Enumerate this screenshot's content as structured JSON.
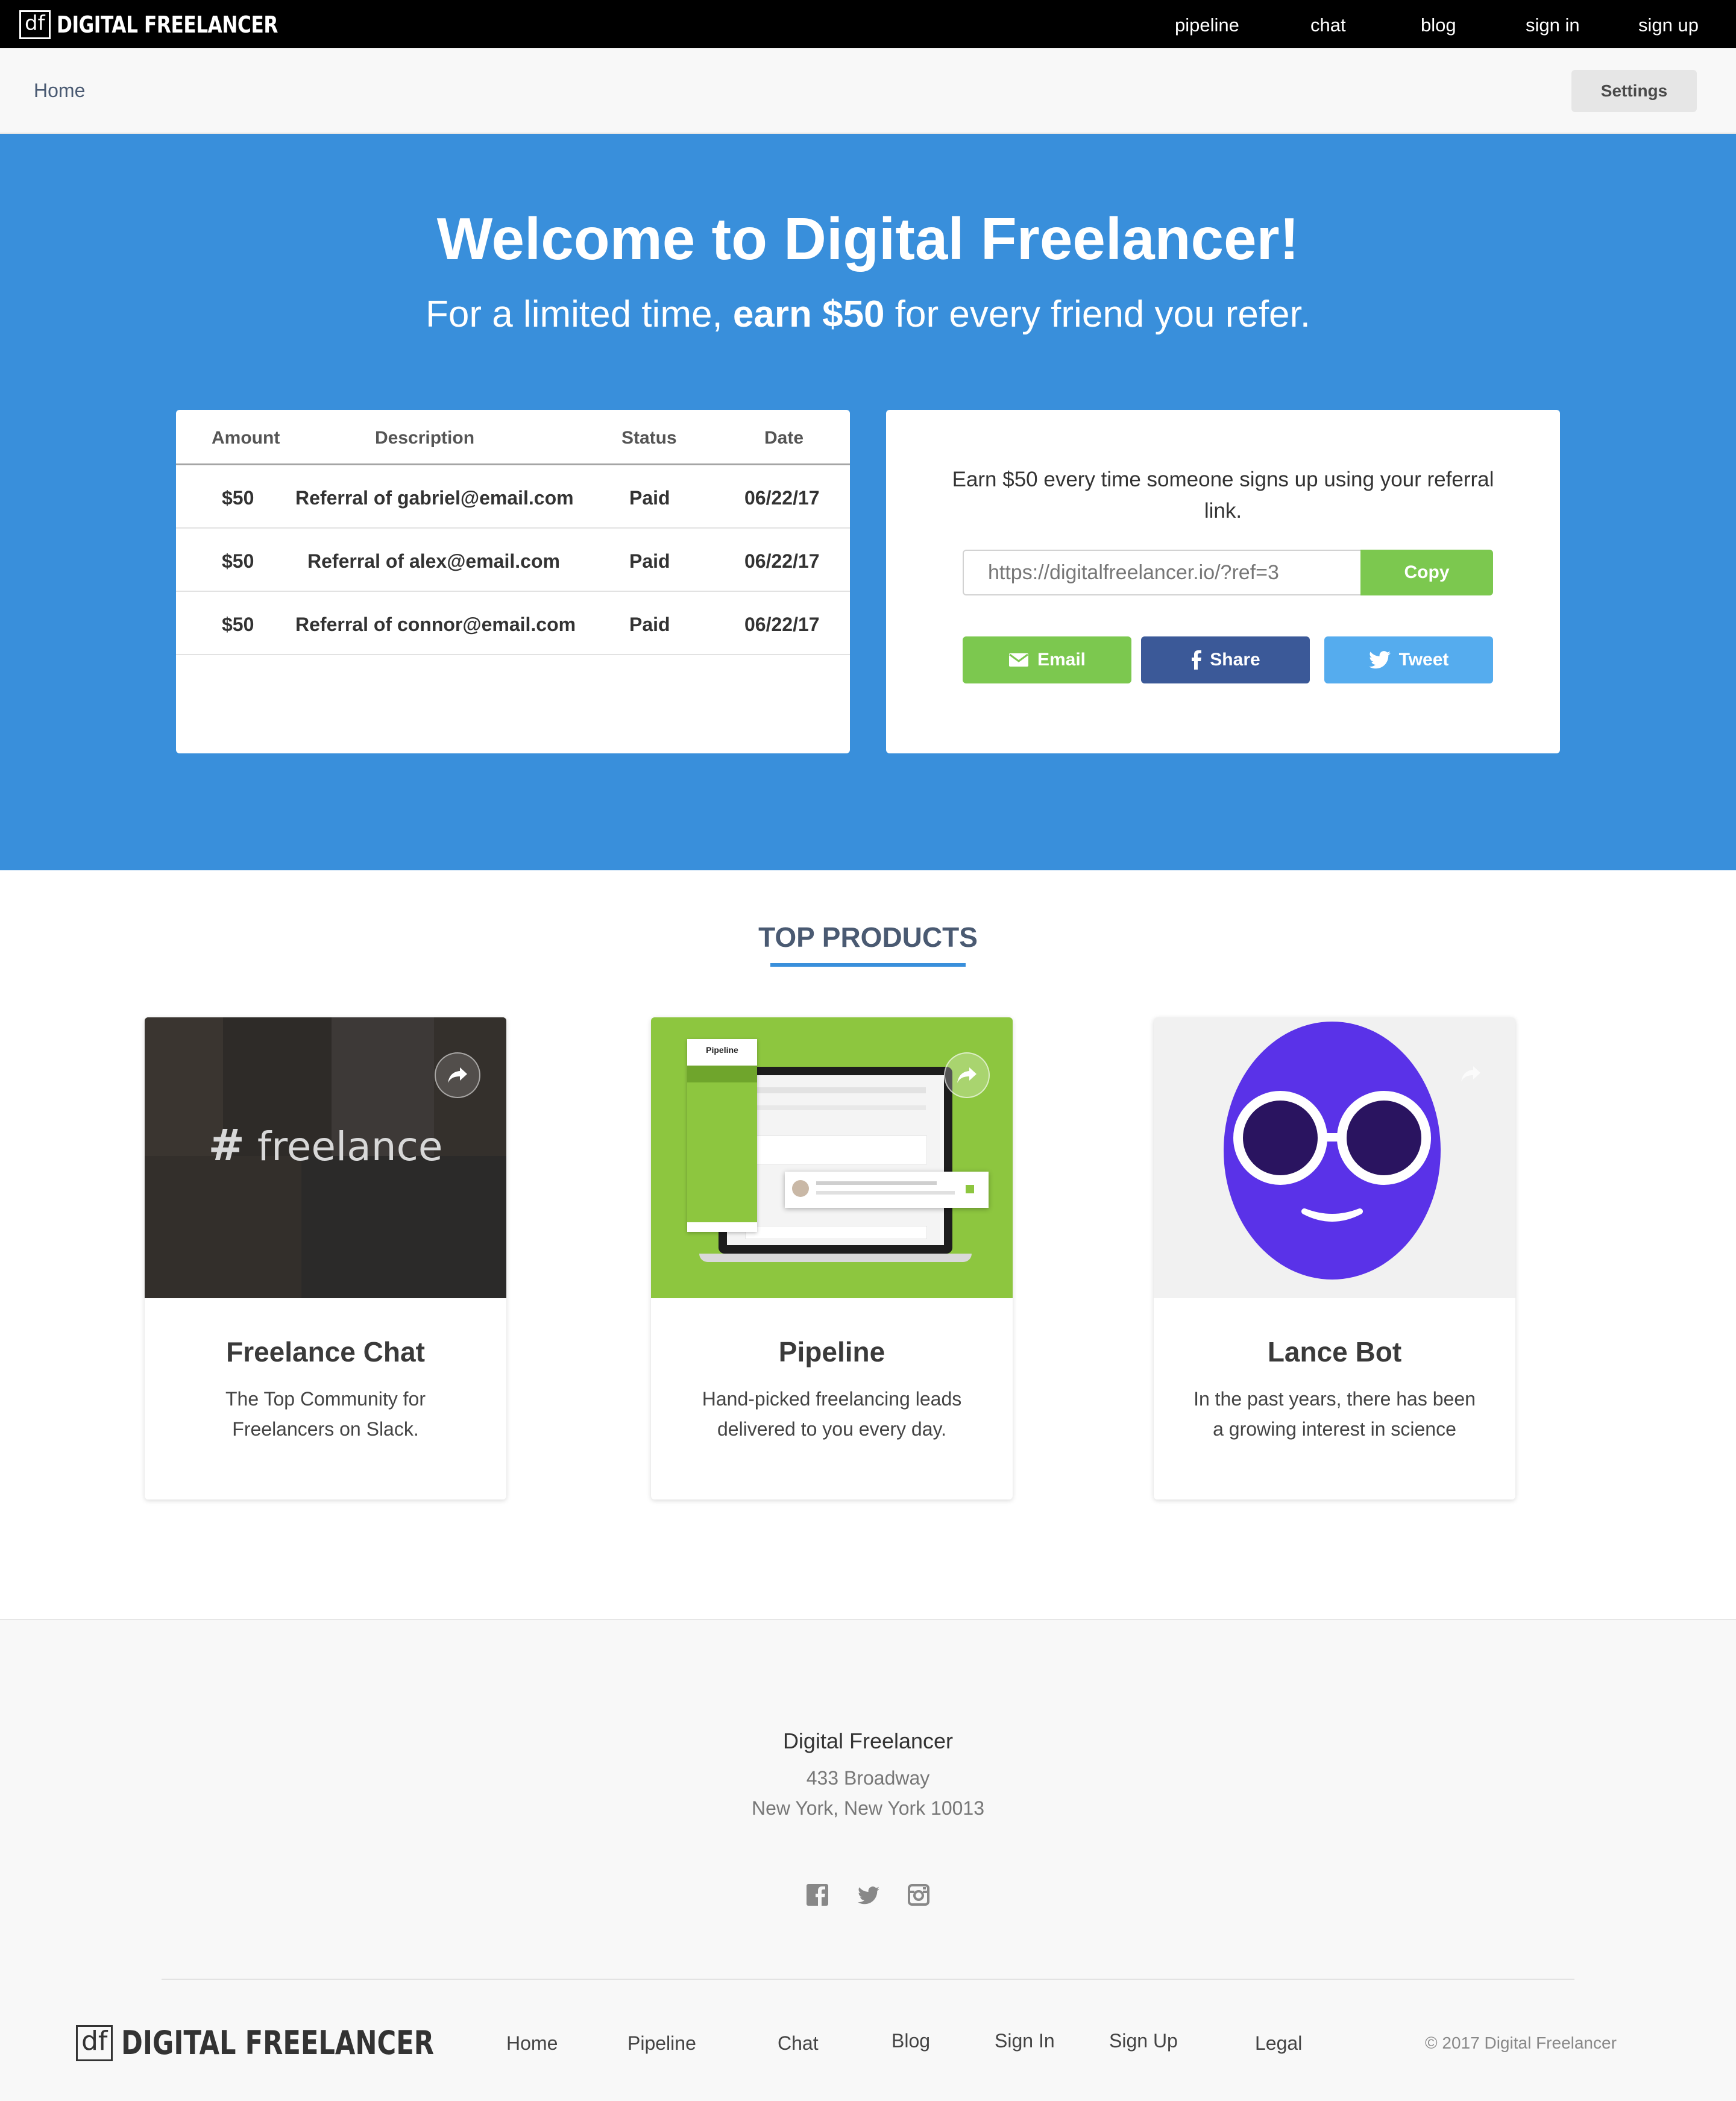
{
  "brand": {
    "logo_mark": "df",
    "logo_text": "DIGITAL FREELANCER"
  },
  "nav": {
    "links": [
      "pipeline",
      "chat",
      "blog",
      "sign in",
      "sign up"
    ]
  },
  "subheader": {
    "breadcrumb": "Home",
    "settings_label": "Settings"
  },
  "hero": {
    "title": "Welcome to Digital Freelancer!",
    "subtitle_pre": "For a limited time, ",
    "subtitle_bold": "earn $50",
    "subtitle_post": " for every friend you refer."
  },
  "referrals_table": {
    "headers": [
      "Amount",
      "Description",
      "Status",
      "Date"
    ],
    "rows": [
      {
        "amount": "$50",
        "description": "Referral of gabriel@email.com",
        "status": "Paid",
        "date": "06/22/17"
      },
      {
        "amount": "$50",
        "description": "Referral of alex@email.com",
        "status": "Paid",
        "date": "06/22/17"
      },
      {
        "amount": "$50",
        "description": "Referral of connor@email.com",
        "status": "Paid",
        "date": "06/22/17"
      }
    ]
  },
  "referral_card": {
    "text": "Earn $50 every time someone signs up using your referral link.",
    "link_value": "https://digitalfreelancer.io/?ref=3",
    "copy_label": "Copy",
    "email_label": "Email",
    "share_label": "Share",
    "tweet_label": "Tweet",
    "icons": [
      "mail-icon",
      "facebook-icon",
      "twitter-icon"
    ]
  },
  "products": {
    "section_title": "TOP PRODUCTS",
    "items": [
      {
        "title": "Freelance Chat",
        "description": "The Top Community for Freelancers on Slack.",
        "image_text": "freelance"
      },
      {
        "title": "Pipeline",
        "description": "Hand-picked freelancing leads delivered to you every day.",
        "image_text": "Pipeline"
      },
      {
        "title": "Lance Bot",
        "description": "In the past years, there has been a growing interest in science"
      }
    ]
  },
  "footer": {
    "company": "Digital Freelancer",
    "address_line1": "433 Broadway",
    "address_line2": "New York, New York 10013",
    "social_icons": [
      "facebook-icon",
      "twitter-icon",
      "instagram-icon"
    ],
    "links": [
      "Home",
      "Pipeline",
      "Chat",
      "Blog",
      "Sign In",
      "Sign Up",
      "Legal"
    ],
    "copyright": "© 2017 Digital Freelancer"
  },
  "colors": {
    "hero_blue": "#398fdb",
    "green": "#7cc84f",
    "facebook": "#3b5998",
    "twitter": "#55acee",
    "lance_bot_purple": "#5a32e8"
  }
}
